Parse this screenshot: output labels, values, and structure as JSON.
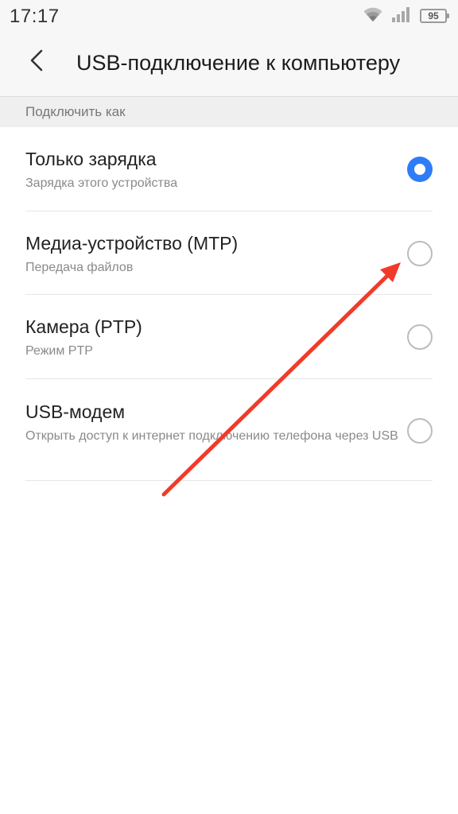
{
  "status_bar": {
    "time": "17:17",
    "battery": "95",
    "icons": [
      "wifi-icon",
      "signal-icon",
      "battery-icon"
    ]
  },
  "header": {
    "back_icon": "chevron-left-icon",
    "title": "USB-подключение к компьютеру"
  },
  "section": {
    "label": "Подключить как"
  },
  "options": [
    {
      "title": "Только зарядка",
      "subtitle": "Зарядка этого устройства",
      "checked": true
    },
    {
      "title": "Медиа-устройство (MTP)",
      "subtitle": "Передача файлов",
      "checked": false
    },
    {
      "title": "Камера (PTP)",
      "subtitle": "Режим PTP",
      "checked": false
    },
    {
      "title": "USB-модем",
      "subtitle": "Открыть доступ к интернет подключению телефона через USB",
      "checked": false
    }
  ],
  "colors": {
    "accent": "#2f7cf6",
    "annotation_arrow": "#f23a2a",
    "header_bg": "#f7f7f7",
    "section_bg": "#efefef"
  }
}
